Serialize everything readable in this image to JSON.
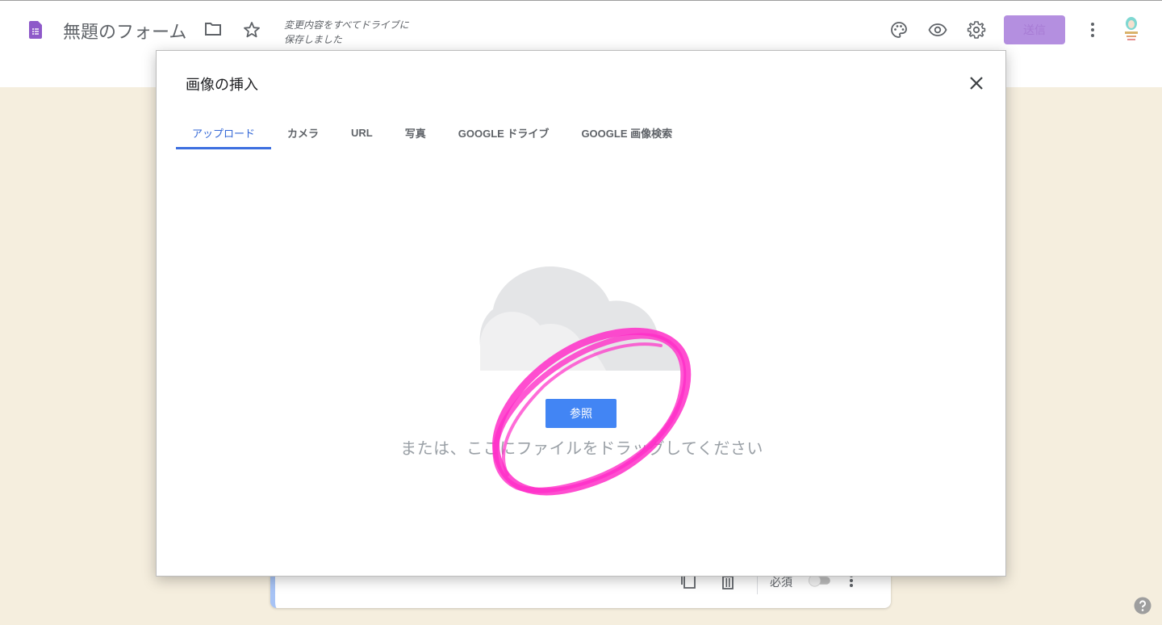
{
  "header": {
    "form_title": "無題のフォーム",
    "save_status_line1": "変更内容をすべてドライブに",
    "save_status_line2": "保存しました",
    "send_label": "送信"
  },
  "modal": {
    "title": "画像の挿入",
    "tabs": [
      {
        "label": "アップロード",
        "active": true
      },
      {
        "label": "カメラ"
      },
      {
        "label": "URL"
      },
      {
        "label": "写真"
      },
      {
        "label": "GOOGLE ドライブ"
      },
      {
        "label": "GOOGLE 画像検索"
      }
    ],
    "browse_label": "参照",
    "drop_hint": "または、ここにファイルをドラッグしてください"
  },
  "question_card": {
    "required_label": "必須",
    "required_on": false
  },
  "colors": {
    "accent": "#4285f4",
    "tab_active": "#3367d6",
    "background": "#f5eede",
    "send_button": "#b48fe0",
    "highlight_circle": "#ff33cc"
  },
  "icons": [
    "forms-doc-icon",
    "folder-icon",
    "star-icon",
    "palette-icon",
    "eye-icon",
    "gear-icon",
    "more-vert-icon",
    "avatar",
    "close-icon",
    "cloud-icon",
    "copy-icon",
    "trash-icon",
    "help-icon"
  ]
}
